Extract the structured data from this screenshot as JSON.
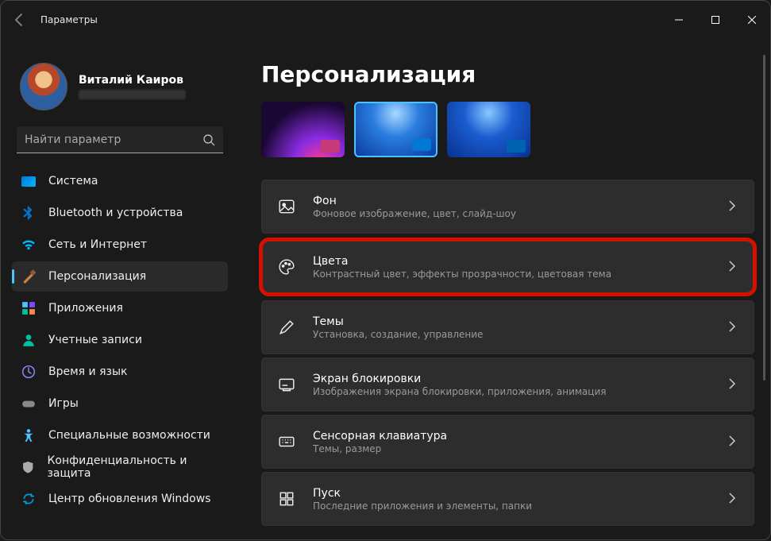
{
  "window": {
    "title": "Параметры"
  },
  "profile": {
    "name": "Виталий Каиров"
  },
  "search": {
    "placeholder": "Найти параметр"
  },
  "sidebar": {
    "items": [
      {
        "label": "Система"
      },
      {
        "label": "Bluetooth и устройства"
      },
      {
        "label": "Сеть и Интернет"
      },
      {
        "label": "Персонализация"
      },
      {
        "label": "Приложения"
      },
      {
        "label": "Учетные записи"
      },
      {
        "label": "Время и язык"
      },
      {
        "label": "Игры"
      },
      {
        "label": "Специальные возможности"
      },
      {
        "label": "Конфиденциальность и защита"
      },
      {
        "label": "Центр обновления Windows"
      }
    ]
  },
  "page": {
    "title": "Персонализация"
  },
  "cards": [
    {
      "title": "Фон",
      "sub": "Фоновое изображение, цвет, слайд-шоу"
    },
    {
      "title": "Цвета",
      "sub": "Контрастный цвет, эффекты прозрачности, цветовая тема"
    },
    {
      "title": "Темы",
      "sub": "Установка, создание, управление"
    },
    {
      "title": "Экран блокировки",
      "sub": "Изображения экрана блокировки, приложения, анимация"
    },
    {
      "title": "Сенсорная клавиатура",
      "sub": "Темы, размер"
    },
    {
      "title": "Пуск",
      "sub": "Последние приложения и элементы, папки"
    }
  ]
}
